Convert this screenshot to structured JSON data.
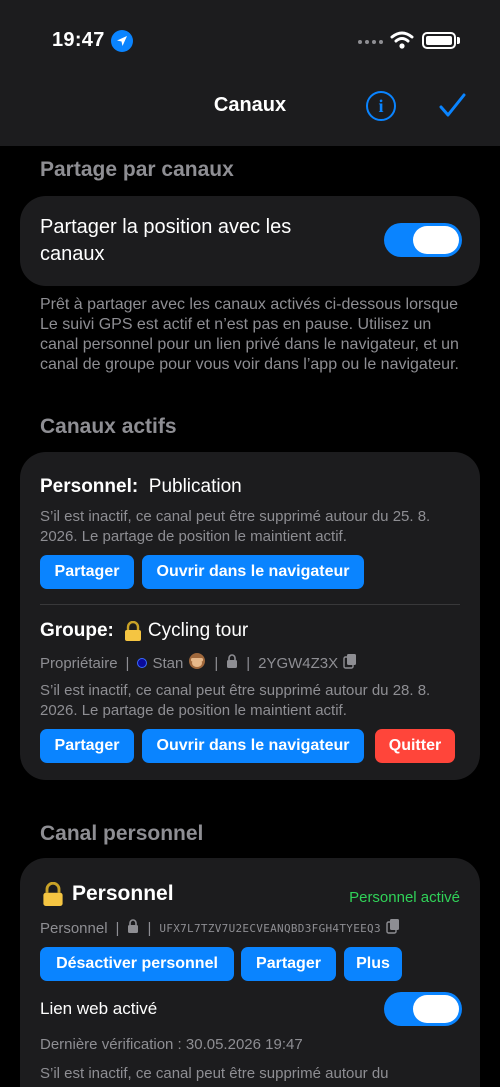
{
  "status_bar": {
    "time": "19:47"
  },
  "nav": {
    "title": "Canaux"
  },
  "sharing": {
    "header": "Partage par canaux",
    "toggle_label": "Partager la position avec les canaux",
    "toggle_on": true,
    "footer": "Prêt à partager avec les canaux activés ci-dessous lorsque Le suivi GPS est actif et n’est pas en pause. Utilisez un canal personnel pour un lien privé dans le navigateur, et un canal de groupe pour vous voir dans l’app ou le navigateur."
  },
  "active_channels": {
    "header": "Canaux actifs",
    "personal": {
      "kind": "Personnel:",
      "name": "Publication",
      "note": "S’il est inactif, ce canal peut être supprimé autour du 25. 8. 2026. Le partage de position le maintient actif.",
      "share_button": "Partager",
      "open_button": "Ouvrir dans le navigateur"
    },
    "group": {
      "kind": "Groupe:",
      "name": "Cycling tour",
      "role": "Propriétaire",
      "member": "Stan",
      "code": "2YGW4Z3X",
      "note": "S’il est inactif, ce canal peut être supprimé autour du 28. 8. 2026. Le partage de position le maintient actif.",
      "share_button": "Partager",
      "open_button": "Ouvrir dans le navigateur",
      "leave_button": "Quitter"
    }
  },
  "personal_channel": {
    "header": "Canal personnel",
    "title": "Personnel",
    "status": "Personnel activé",
    "type_label": "Personnel",
    "key": "UFX7L7TZV7U2ECVEANQBD3FGH4TYEEQ3",
    "disable_button": "Désactiver personnel",
    "share_button": "Partager",
    "more_button": "Plus",
    "web_link_label": "Lien web activé",
    "web_link_on": true,
    "last_check": "Dernière vérification : 30.05.2026 19:47",
    "note": "S’il est inactif, ce canal peut être supprimé autour du"
  },
  "colors": {
    "accent": "#0a84ff",
    "destructive": "#ff453a",
    "success": "#30d158"
  }
}
